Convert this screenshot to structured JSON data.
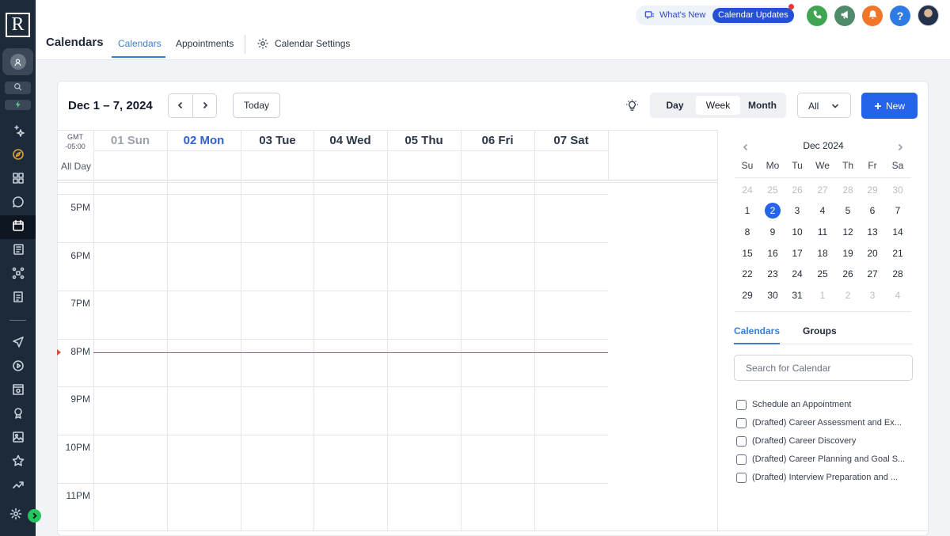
{
  "app": {
    "logo_letter": "R"
  },
  "sidebar": {
    "items": [
      {
        "name": "account-icon"
      },
      {
        "name": "search-icon"
      },
      {
        "name": "lightning-icon"
      },
      {
        "name": "sparkles-icon"
      },
      {
        "name": "compass-icon"
      },
      {
        "name": "dashboard-icon"
      },
      {
        "name": "chat-icon"
      },
      {
        "name": "calendar-icon",
        "active": true
      },
      {
        "name": "contacts-icon"
      },
      {
        "name": "workflow-icon"
      },
      {
        "name": "clipboard-icon"
      },
      {
        "name": "send-icon"
      },
      {
        "name": "play-icon"
      },
      {
        "name": "website-icon"
      },
      {
        "name": "badge-icon"
      },
      {
        "name": "image-icon"
      },
      {
        "name": "star-icon"
      },
      {
        "name": "trending-icon"
      },
      {
        "name": "gear-icon"
      }
    ]
  },
  "header": {
    "title": "Calendars",
    "tabs": [
      {
        "label": "Calendars",
        "active": true
      },
      {
        "label": "Appointments"
      },
      {
        "label": "Calendar Settings"
      }
    ],
    "whats_new": "What's New",
    "updates_pill": "Calendar Updates",
    "actions": [
      {
        "name": "phone-icon",
        "color": "#3fa552"
      },
      {
        "name": "megaphone-icon",
        "color": "#4f8a6b"
      },
      {
        "name": "bell-icon",
        "color": "#f0762c"
      },
      {
        "name": "help-icon",
        "color": "#2f7be6",
        "label": "?"
      }
    ]
  },
  "toolbar": {
    "range": "Dec 1 – 7, 2024",
    "today": "Today",
    "views": [
      "Day",
      "Week",
      "Month"
    ],
    "active_view": "Week",
    "filter": "All",
    "new": "New"
  },
  "week": {
    "timezone": [
      "GMT",
      "-05:00"
    ],
    "all_day": "All Day",
    "days": [
      {
        "label": "01 Sun",
        "state": "past"
      },
      {
        "label": "02 Mon",
        "state": "today"
      },
      {
        "label": "03 Tue"
      },
      {
        "label": "04 Wed"
      },
      {
        "label": "05 Thu"
      },
      {
        "label": "06 Fri"
      },
      {
        "label": "07 Sat"
      }
    ],
    "hours": [
      "5PM",
      "6PM",
      "7PM",
      "8PM",
      "9PM",
      "10PM",
      "11PM"
    ]
  },
  "mini_calendar": {
    "title": "Dec 2024",
    "weekdays": [
      "Su",
      "Mo",
      "Tu",
      "We",
      "Th",
      "Fr",
      "Sa"
    ],
    "weeks": [
      [
        "24",
        "25",
        "26",
        "27",
        "28",
        "29",
        "30"
      ],
      [
        "1",
        "2",
        "3",
        "4",
        "5",
        "6",
        "7"
      ],
      [
        "8",
        "9",
        "10",
        "11",
        "12",
        "13",
        "14"
      ],
      [
        "15",
        "16",
        "17",
        "18",
        "19",
        "20",
        "21"
      ],
      [
        "22",
        "23",
        "24",
        "25",
        "26",
        "27",
        "28"
      ],
      [
        "29",
        "30",
        "31",
        "1",
        "2",
        "3",
        "4"
      ]
    ],
    "muted_first_row": true,
    "muted_last_row_from": 3,
    "selected": "2"
  },
  "panel": {
    "tabs": [
      {
        "label": "Calendars",
        "active": true
      },
      {
        "label": "Groups"
      }
    ],
    "search_placeholder": "Search for Calendar",
    "calendars": [
      "Schedule an Appointment",
      "(Drafted) Career Assessment and Ex...",
      "(Drafted) Career Discovery",
      "(Drafted) Career Planning and Goal S...",
      "(Drafted) Interview Preparation and ..."
    ]
  }
}
